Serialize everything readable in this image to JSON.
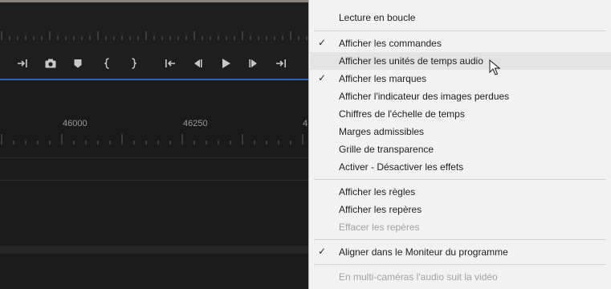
{
  "timeline": {
    "timecode_labels": [
      "46000",
      "46250",
      "4"
    ]
  },
  "toolbar": {
    "buttons": [
      {
        "icon": "insert-arrow-icon"
      },
      {
        "icon": "camera-icon"
      },
      {
        "icon": "marker-icon"
      },
      {
        "icon": "mark-in-icon"
      },
      {
        "icon": "mark-out-icon"
      },
      {
        "icon": "go-to-in-icon"
      },
      {
        "icon": "step-back-icon"
      },
      {
        "icon": "play-icon"
      },
      {
        "icon": "step-forward-icon"
      },
      {
        "icon": "go-to-out-icon"
      }
    ]
  },
  "menu": {
    "items": [
      {
        "label": "Lecture en boucle",
        "checked": false,
        "disabled": false
      },
      {
        "label": "Afficher les commandes",
        "checked": true,
        "disabled": false
      },
      {
        "label": "Afficher les unités de temps audio",
        "checked": false,
        "disabled": false,
        "highlighted": true
      },
      {
        "label": "Afficher les marques",
        "checked": true,
        "disabled": false
      },
      {
        "label": "Afficher l'indicateur des images perdues",
        "checked": false,
        "disabled": false
      },
      {
        "label": "Chiffres de l'échelle de temps",
        "checked": false,
        "disabled": false
      },
      {
        "label": "Marges admissibles",
        "checked": false,
        "disabled": false
      },
      {
        "label": "Grille de transparence",
        "checked": false,
        "disabled": false
      },
      {
        "label": "Activer - Désactiver les effets",
        "checked": false,
        "disabled": false
      },
      {
        "label": "Afficher les règles",
        "checked": false,
        "disabled": false
      },
      {
        "label": "Afficher les repères",
        "checked": false,
        "disabled": false
      },
      {
        "label": "Effacer les repères",
        "checked": false,
        "disabled": true
      },
      {
        "label": "Aligner dans le Moniteur du programme",
        "checked": true,
        "disabled": false
      },
      {
        "label": "En multi-caméras l'audio suit la vidéo",
        "checked": false,
        "disabled": true
      }
    ],
    "checkmark": "✓"
  },
  "colors": {
    "panel_bg": "#1e1e1e",
    "menu_bg": "#f2f2f2",
    "menu_highlight": "#e3e3e3",
    "playhead_blue": "#2d62b8"
  }
}
